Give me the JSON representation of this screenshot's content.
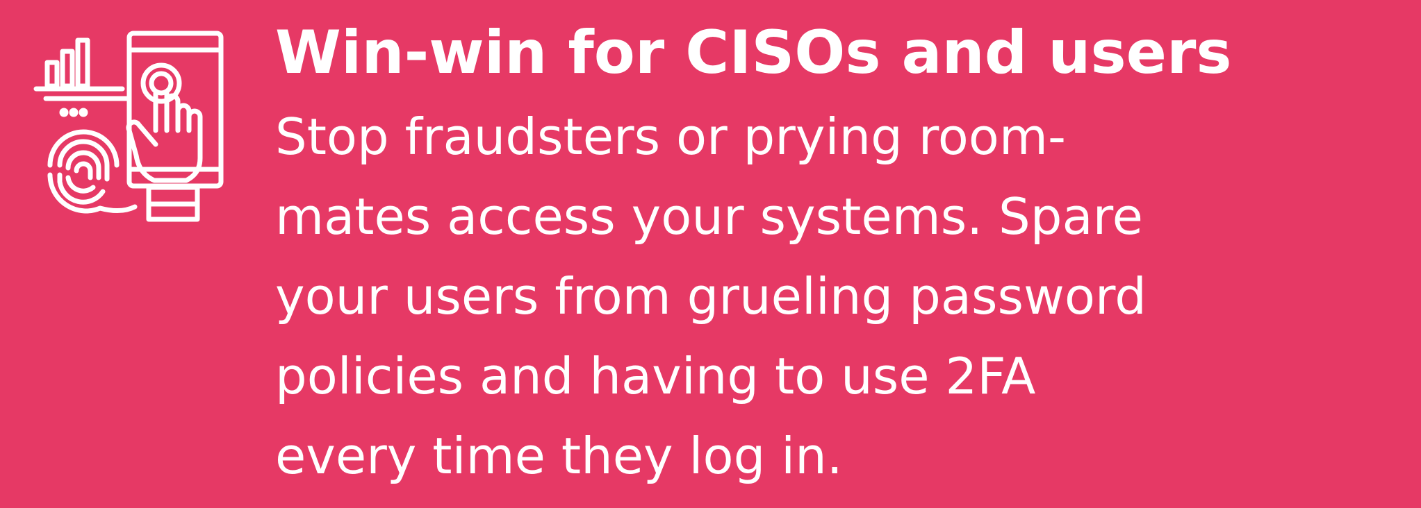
{
  "card": {
    "icon": "fingerprint-touch-screen-icon",
    "background_color": "#e63965",
    "text_color": "#ffffff",
    "title": "Win-win for CISOs and users",
    "body_lines": [
      "Stop fraudsters or prying room-",
      "mates access your systems. Spare",
      "your users from grueling password",
      "policies and having to use 2FA",
      "every time they log in."
    ]
  }
}
